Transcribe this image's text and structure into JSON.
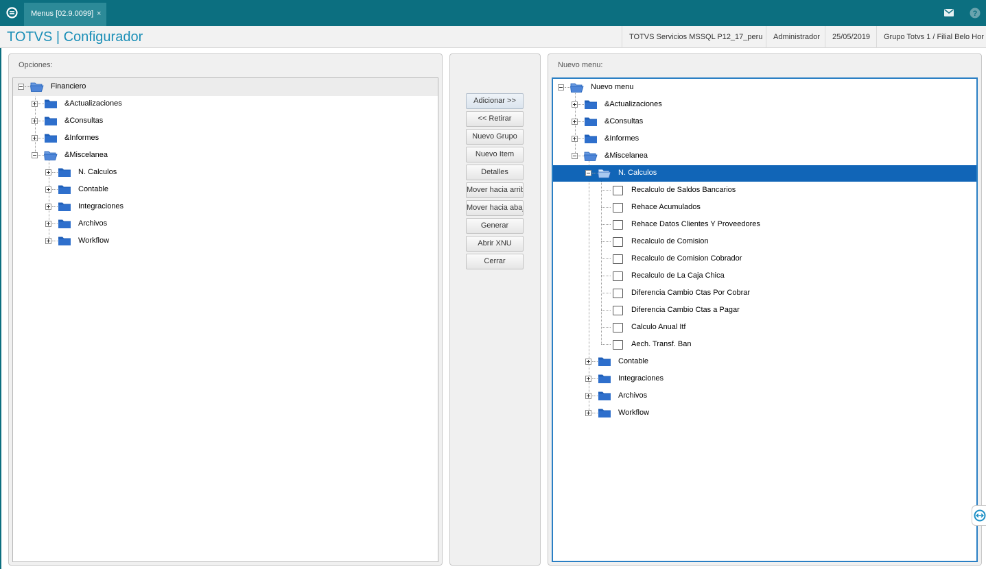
{
  "window": {
    "tab_label": "Menus [02.9.0099]",
    "tab_close": "×"
  },
  "header": {
    "app_title": "TOTVS | Configurador",
    "environment": "TOTVS Servicios MSSQL P12_17_peru",
    "user": "Administrador",
    "date": "25/05/2019",
    "branch": "Grupo Totvs 1 / Filial Belo Hor"
  },
  "left_panel": {
    "label": "Opciones:",
    "tree": [
      {
        "label": "Financiero",
        "level": 0,
        "type": "folder",
        "state": "open"
      },
      {
        "label": "&Actualizaciones",
        "level": 1,
        "type": "folder",
        "state": "closed"
      },
      {
        "label": "&Consultas",
        "level": 1,
        "type": "folder",
        "state": "closed"
      },
      {
        "label": "&Informes",
        "level": 1,
        "type": "folder",
        "state": "closed"
      },
      {
        "label": "&Miscelanea",
        "level": 1,
        "type": "folder",
        "state": "open"
      },
      {
        "label": "N. Calculos",
        "level": 2,
        "type": "folder",
        "state": "closed"
      },
      {
        "label": "Contable",
        "level": 2,
        "type": "folder",
        "state": "closed"
      },
      {
        "label": "Integraciones",
        "level": 2,
        "type": "folder",
        "state": "closed"
      },
      {
        "label": "Archivos",
        "level": 2,
        "type": "folder",
        "state": "closed"
      },
      {
        "label": "Workflow",
        "level": 2,
        "type": "folder",
        "state": "closed"
      }
    ]
  },
  "buttons": [
    {
      "label": "Adicionar >>",
      "name": "add-button"
    },
    {
      "label": "<< Retirar",
      "name": "remove-button"
    },
    {
      "label": "Nuevo Grupo",
      "name": "new-group-button"
    },
    {
      "label": "Nuevo Item",
      "name": "new-item-button"
    },
    {
      "label": "Detalles",
      "name": "details-button"
    },
    {
      "label": "Mover hacia arriba",
      "name": "move-up-button"
    },
    {
      "label": "Mover hacia abajo",
      "name": "move-down-button"
    },
    {
      "label": "Generar",
      "name": "generate-button"
    },
    {
      "label": "Abrir XNU",
      "name": "open-xnu-button"
    },
    {
      "label": "Cerrar",
      "name": "close-button"
    }
  ],
  "right_panel": {
    "label": "Nuevo menu:",
    "tree": [
      {
        "label": "Nuevo menu",
        "level": 0,
        "type": "folder",
        "state": "open"
      },
      {
        "label": "&Actualizaciones",
        "level": 1,
        "type": "folder",
        "state": "closed"
      },
      {
        "label": "&Consultas",
        "level": 1,
        "type": "folder",
        "state": "closed"
      },
      {
        "label": "&Informes",
        "level": 1,
        "type": "folder",
        "state": "closed"
      },
      {
        "label": "&Miscelanea",
        "level": 1,
        "type": "folder",
        "state": "open"
      },
      {
        "label": "N. Calculos",
        "level": 2,
        "type": "folder",
        "state": "open",
        "selected": true
      },
      {
        "label": "Recalculo de Saldos Bancarios",
        "level": 3,
        "type": "item"
      },
      {
        "label": "Rehace Acumulados",
        "level": 3,
        "type": "item"
      },
      {
        "label": "Rehace Datos Clientes Y Proveedores",
        "level": 3,
        "type": "item"
      },
      {
        "label": "Recalculo de Comision",
        "level": 3,
        "type": "item"
      },
      {
        "label": "Recalculo de Comision Cobrador",
        "level": 3,
        "type": "item"
      },
      {
        "label": "Recalculo de La Caja Chica",
        "level": 3,
        "type": "item"
      },
      {
        "label": "Diferencia Cambio Ctas Por Cobrar",
        "level": 3,
        "type": "item"
      },
      {
        "label": "Diferencia Cambio Ctas a Pagar",
        "level": 3,
        "type": "item"
      },
      {
        "label": "Calculo Anual Itf",
        "level": 3,
        "type": "item"
      },
      {
        "label": "Aech. Transf. Ban",
        "level": 3,
        "type": "item"
      },
      {
        "label": "Contable",
        "level": 2,
        "type": "folder",
        "state": "closed"
      },
      {
        "label": "Integraciones",
        "level": 2,
        "type": "folder",
        "state": "closed"
      },
      {
        "label": "Archivos",
        "level": 2,
        "type": "folder",
        "state": "closed"
      },
      {
        "label": "Workflow",
        "level": 2,
        "type": "folder",
        "state": "closed"
      }
    ]
  },
  "colors": {
    "topbar": "#0c6f80",
    "title": "#1b8fb7",
    "selection": "#1165b7",
    "folder": "#1f5fb8"
  }
}
